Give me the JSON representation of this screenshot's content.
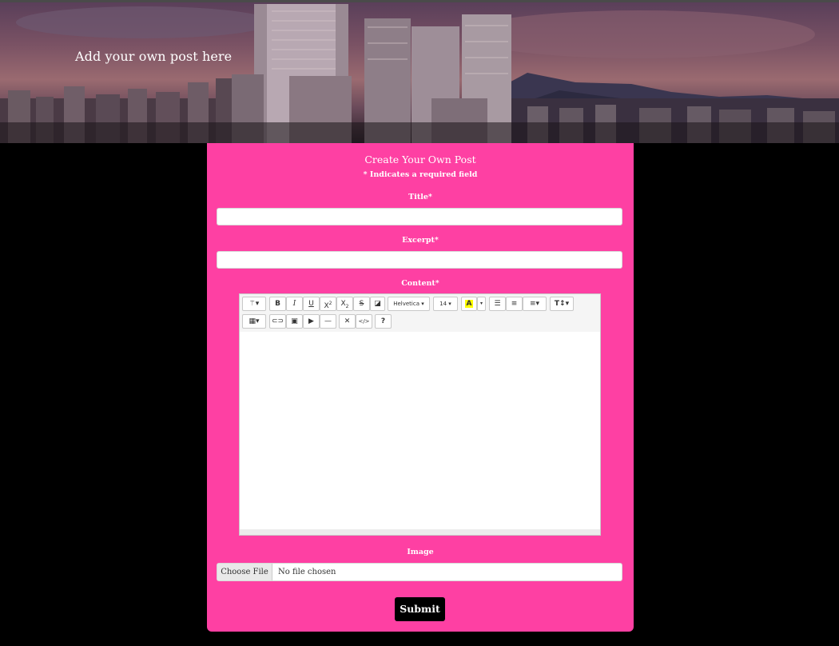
{
  "hero": {
    "title": "Add your own post here"
  },
  "form": {
    "title": "Create Your Own Post",
    "required_note": "* Indicates a required field",
    "fields": {
      "title_label": "Title*",
      "excerpt_label": "Excerpt*",
      "content_label": "Content*",
      "image_label": "Image"
    },
    "editor": {
      "font_name": "Helvetica",
      "font_size": "14",
      "bold": "B",
      "italic": "I",
      "underline": "U",
      "superscript": "X",
      "subscript": "X",
      "strikethrough": "S",
      "color_letter": "A",
      "style": "T",
      "help": "?"
    },
    "file": {
      "button": "Choose File",
      "status": "No file chosen"
    },
    "submit_label": "Submit"
  },
  "colors": {
    "accent": "#fe40a3",
    "background": "#000000"
  }
}
